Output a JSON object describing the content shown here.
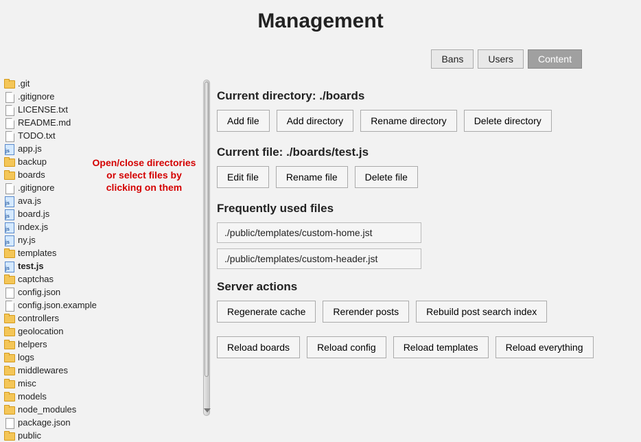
{
  "title": "Management",
  "tabs": [
    {
      "label": "Bans",
      "active": false
    },
    {
      "label": "Users",
      "active": false
    },
    {
      "label": "Content",
      "active": true
    }
  ],
  "hint_text": "Open/close directories or select files by clicking on them",
  "tree": [
    {
      "type": "folder-open",
      "label": ".git",
      "depth": 0
    },
    {
      "type": "file-txt",
      "label": ".gitignore",
      "depth": 0
    },
    {
      "type": "file-txt",
      "label": "LICENSE.txt",
      "depth": 0
    },
    {
      "type": "file-txt",
      "label": "README.md",
      "depth": 0
    },
    {
      "type": "file-txt",
      "label": "TODO.txt",
      "depth": 0
    },
    {
      "type": "file-js",
      "label": "app.js",
      "depth": 0
    },
    {
      "type": "folder-open",
      "label": "backup",
      "depth": 0
    },
    {
      "type": "folder-open",
      "label": "boards",
      "depth": 0
    },
    {
      "type": "file-txt",
      "label": ".gitignore",
      "depth": 1
    },
    {
      "type": "file-js",
      "label": "ava.js",
      "depth": 1
    },
    {
      "type": "file-js",
      "label": "board.js",
      "depth": 1
    },
    {
      "type": "file-js",
      "label": "index.js",
      "depth": 1
    },
    {
      "type": "file-js",
      "label": "ny.js",
      "depth": 1
    },
    {
      "type": "folder-open",
      "label": "templates",
      "depth": 1
    },
    {
      "type": "file-js",
      "label": "test.js",
      "depth": 1,
      "bold": true
    },
    {
      "type": "folder-open",
      "label": "captchas",
      "depth": 0
    },
    {
      "type": "file-json",
      "label": "config.json",
      "depth": 0
    },
    {
      "type": "file-txt",
      "label": "config.json.example",
      "depth": 0
    },
    {
      "type": "folder-open",
      "label": "controllers",
      "depth": 0
    },
    {
      "type": "folder-open",
      "label": "geolocation",
      "depth": 0
    },
    {
      "type": "folder-open",
      "label": "helpers",
      "depth": 0
    },
    {
      "type": "folder-open",
      "label": "logs",
      "depth": 0
    },
    {
      "type": "folder-open",
      "label": "middlewares",
      "depth": 0
    },
    {
      "type": "folder-open",
      "label": "misc",
      "depth": 0
    },
    {
      "type": "folder-open",
      "label": "models",
      "depth": 0
    },
    {
      "type": "folder-open",
      "label": "node_modules",
      "depth": 0
    },
    {
      "type": "file-json",
      "label": "package.json",
      "depth": 0
    },
    {
      "type": "folder-open",
      "label": "public",
      "depth": 0
    }
  ],
  "current_dir": {
    "heading_prefix": "Current directory: ",
    "path": "./boards",
    "actions": [
      "Add file",
      "Add directory",
      "Rename directory",
      "Delete directory"
    ]
  },
  "current_file": {
    "heading_prefix": "Current file: ",
    "path": "./boards/test.js",
    "actions": [
      "Edit file",
      "Rename file",
      "Delete file"
    ]
  },
  "frequent": {
    "heading": "Frequently used files",
    "items": [
      "./public/templates/custom-home.jst",
      "./public/templates/custom-header.jst"
    ]
  },
  "server_actions": {
    "heading": "Server actions",
    "row1": [
      "Regenerate cache",
      "Rerender posts",
      "Rebuild post search index"
    ],
    "row2": [
      "Reload boards",
      "Reload config",
      "Reload templates",
      "Reload everything"
    ]
  }
}
